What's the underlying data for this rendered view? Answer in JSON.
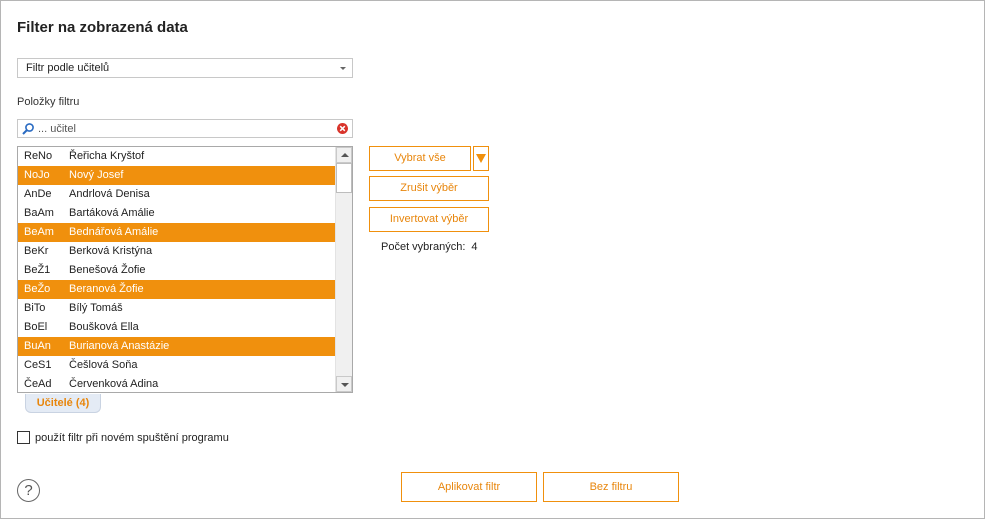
{
  "dialog": {
    "title": "Filter na zobrazená data"
  },
  "filter_mode": {
    "selected": "Filtr podle učitelů"
  },
  "items_section": {
    "label": "Položky filtru"
  },
  "search": {
    "placeholder": "... učitel",
    "icon": "search-icon",
    "clear_icon": "clear-icon"
  },
  "list": {
    "rows": [
      {
        "code": "ReNo",
        "name": "Řeřicha Kryštof",
        "selected": false
      },
      {
        "code": "NoJo",
        "name": "Nový Josef",
        "selected": true
      },
      {
        "code": "AnDe",
        "name": "Andrlová Denisa",
        "selected": false
      },
      {
        "code": "BaAm",
        "name": "Bartáková Amálie",
        "selected": false
      },
      {
        "code": "BeAm",
        "name": "Bednářová Amálie",
        "selected": true
      },
      {
        "code": "BeKr",
        "name": "Berková Kristýna",
        "selected": false
      },
      {
        "code": "BeŽ1",
        "name": "Benešová Žofie",
        "selected": false
      },
      {
        "code": "BeŽo",
        "name": "Beranová Žofie",
        "selected": true
      },
      {
        "code": "BiTo",
        "name": "Bílý Tomáš",
        "selected": false
      },
      {
        "code": "BoEl",
        "name": "Boušková Ella",
        "selected": false
      },
      {
        "code": "BuAn",
        "name": "Burianová Anastázie",
        "selected": true
      },
      {
        "code": "CeS1",
        "name": "Češlová Soňa",
        "selected": false
      },
      {
        "code": "ČeAd",
        "name": "Červenková Adina",
        "selected": false
      }
    ],
    "tab_label": "Učitelé (4)"
  },
  "actions": {
    "select_all": "Vybrat vše",
    "cancel_selection": "Zrušit výběr",
    "invert_selection": "Invertovat výběr",
    "count_label": "Počet vybraných:",
    "count_value": "4"
  },
  "options": {
    "use_on_startup_label": "použít filtr při novém spuštění programu",
    "use_on_startup_checked": false
  },
  "footer": {
    "help_glyph": "?",
    "apply_label": "Aplikovat filtr",
    "no_filter_label": "Bez filtru"
  },
  "colors": {
    "accent": "#f0900d",
    "selection": "#f0900d",
    "tab_bg": "#e4ebf5"
  }
}
